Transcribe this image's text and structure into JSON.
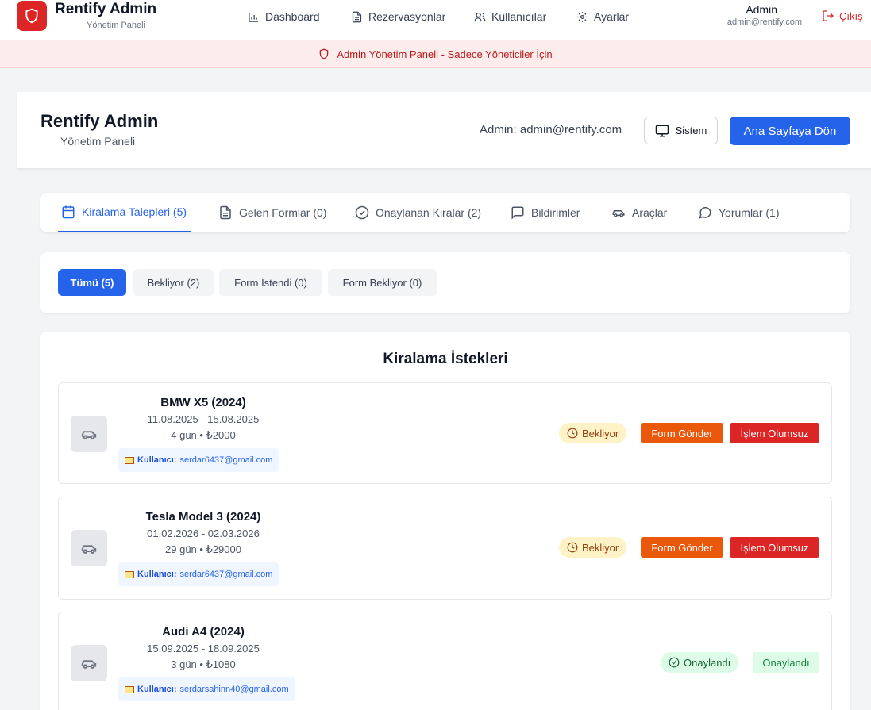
{
  "nav": {
    "brand_title": "Rentify Admin",
    "brand_sub": "Yönetim Paneli",
    "items": [
      {
        "label": "Dashboard",
        "icon": "bar-chart-icon"
      },
      {
        "label": "Rezervasyonlar",
        "icon": "document-icon"
      },
      {
        "label": "Kullanıcılar",
        "icon": "users-icon"
      },
      {
        "label": "Ayarlar",
        "icon": "gear-icon"
      }
    ],
    "admin_name": "Admin",
    "admin_email": "admin@rentify.com",
    "logout_label": "Çıkış"
  },
  "banner": {
    "text": "Admin Yönetim Paneli - Sadece Yöneticiler İçin"
  },
  "header": {
    "title": "Rentify Admin",
    "subtitle": "Yönetim Paneli",
    "admin_text": "Admin: admin@rentify.com",
    "sistem_label": "Sistem",
    "home_label": "Ana Sayfaya Dön"
  },
  "tabs": [
    {
      "label": "Kiralama Talepleri (5)",
      "icon": "calendar-icon",
      "active": true
    },
    {
      "label": "Gelen Formlar (0)",
      "icon": "document-icon",
      "active": false
    },
    {
      "label": "Onaylanan Kiralar (2)",
      "icon": "check-circle-icon",
      "active": false
    },
    {
      "label": "Bildirimler",
      "icon": "message-square-icon",
      "active": false
    },
    {
      "label": "Araçlar",
      "icon": "car-icon",
      "active": false
    },
    {
      "label": "Yorumlar (1)",
      "icon": "message-circle-icon",
      "active": false
    }
  ],
  "filters": [
    {
      "label": "Tümü (5)",
      "active": true
    },
    {
      "label": "Bekliyor (2)",
      "active": false
    },
    {
      "label": "Form İstendi (0)",
      "active": false
    },
    {
      "label": "Form Bekliyor (0)",
      "active": false
    }
  ],
  "list": {
    "title": "Kiralama İstekleri",
    "user_prefix": "Kullanıcı:",
    "requests": [
      {
        "car": "BMW X5 (2024)",
        "dates": "11.08.2025 - 15.08.2025",
        "meta": "4 gün • ₺2000",
        "user": "serdar6437@gmail.com",
        "status": "Bekliyor",
        "actions": [
          "Form Gönder",
          "İşlem Olumsuz"
        ]
      },
      {
        "car": "Tesla Model 3 (2024)",
        "dates": "01.02.2026 - 02.03.2026",
        "meta": "29 gün • ₺29000",
        "user": "serdar6437@gmail.com",
        "status": "Bekliyor",
        "actions": [
          "Form Gönder",
          "İşlem Olumsuz"
        ]
      },
      {
        "car": "Audi A4 (2024)",
        "dates": "15.09.2025 - 18.09.2025",
        "meta": "3 gün • ₺1080",
        "user": "serdarsahinn40@gmail.com",
        "status": "Onaylandı",
        "actions": [
          "Onaylandı"
        ]
      }
    ]
  },
  "colors": {
    "primary": "#2563eb",
    "danger": "#dc2626",
    "orange": "#ea580c",
    "pending_bg": "#fef3c7",
    "approved_bg": "#dcfce7"
  }
}
